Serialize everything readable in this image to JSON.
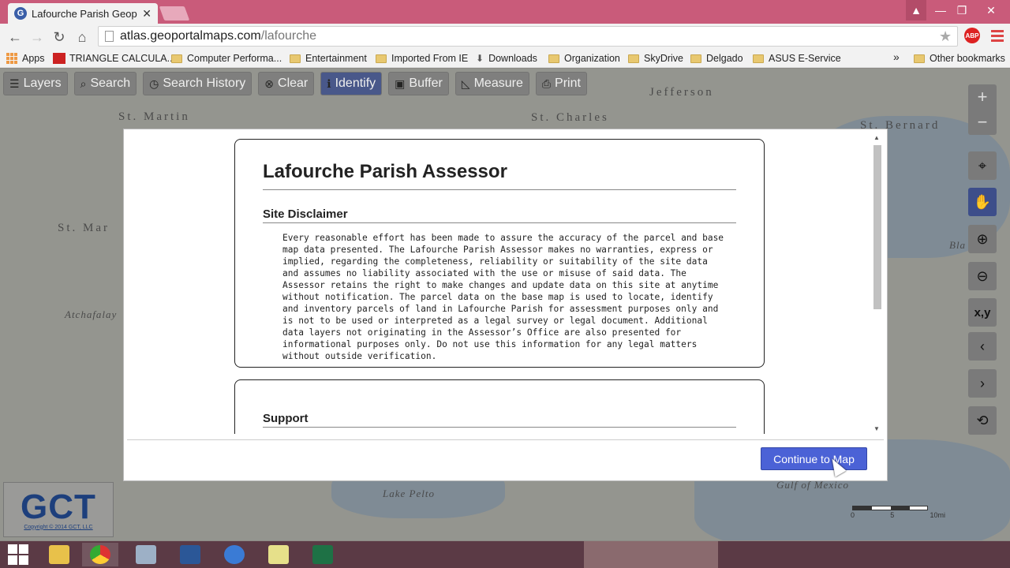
{
  "browser": {
    "tab_title": "Lafourche Parish Geoporta",
    "tab_favicon": "G",
    "url_host": "atlas.geoportalmaps.com",
    "url_path": "/lafourche",
    "abp_label": "ABP",
    "bookmarks": [
      {
        "label": "Apps",
        "icon": "apps-grid-icon"
      },
      {
        "label": "TRIANGLE CALCULA...",
        "icon": "triangle-calc-icon"
      },
      {
        "label": "Computer Performa...",
        "icon": "folder-icon"
      },
      {
        "label": "Entertainment",
        "icon": "folder-icon"
      },
      {
        "label": "Imported From IE",
        "icon": "folder-icon"
      },
      {
        "label": "Downloads",
        "icon": "download-icon"
      },
      {
        "label": "Organization",
        "icon": "folder-icon"
      },
      {
        "label": "SkyDrive",
        "icon": "folder-icon"
      },
      {
        "label": "Delgado",
        "icon": "folder-icon"
      },
      {
        "label": "ASUS E-Service",
        "icon": "folder-icon"
      }
    ],
    "more_bookmarks": "»",
    "other_bookmarks": "Other bookmarks"
  },
  "map": {
    "tools": [
      {
        "label": "Layers",
        "icon": "layers-icon"
      },
      {
        "label": "Search",
        "icon": "search-icon"
      },
      {
        "label": "Search History",
        "icon": "clock-icon"
      },
      {
        "label": "Clear",
        "icon": "clear-icon"
      },
      {
        "label": "Identify",
        "icon": "info-icon"
      },
      {
        "label": "Buffer",
        "icon": "buffer-icon"
      },
      {
        "label": "Measure",
        "icon": "ruler-icon"
      },
      {
        "label": "Print",
        "icon": "printer-icon"
      }
    ],
    "place_labels": [
      "Jefferson",
      "St. Martin",
      "St. Charles",
      "St. Bernard",
      "St. Mar",
      "Atchafalay",
      "Bla",
      "Lake Pelto",
      "Gulf of Mexico"
    ],
    "xy_label": "x,y",
    "scale_labels": [
      "0",
      "5",
      "10mi"
    ],
    "logo_text": "GCT",
    "logo_copyright": "Copyright © 2014 GCT, LLC"
  },
  "modal": {
    "title": "Lafourche Parish Assessor",
    "disclaimer_heading": "Site Disclaimer",
    "disclaimer_text": "Every reasonable effort has been made to assure the accuracy of the parcel and base map data presented. The Lafourche Parish Assessor makes no warranties, express or implied, regarding the completeness, reliability or suitability of the site data and assumes no liability associated with the use or misuse of said data. The Assessor retains the right to make changes and update data on this site at anytime without notification. The parcel data on the base map is used to locate, identify and inventory parcels of land in Lafourche Parish for assessment purposes only and is not to be used or interpreted as a legal survey or legal document. Additional data layers not originating in the Assessor’s Office are also presented for informational purposes only. Do not use this information for any legal matters without outside verification.",
    "support_heading": "Support",
    "continue_label": "Continue to Map"
  },
  "colors": {
    "accent": "#4b62d6",
    "active_tool": "#3d4e8a",
    "tabstrip": "#c95b7a"
  }
}
